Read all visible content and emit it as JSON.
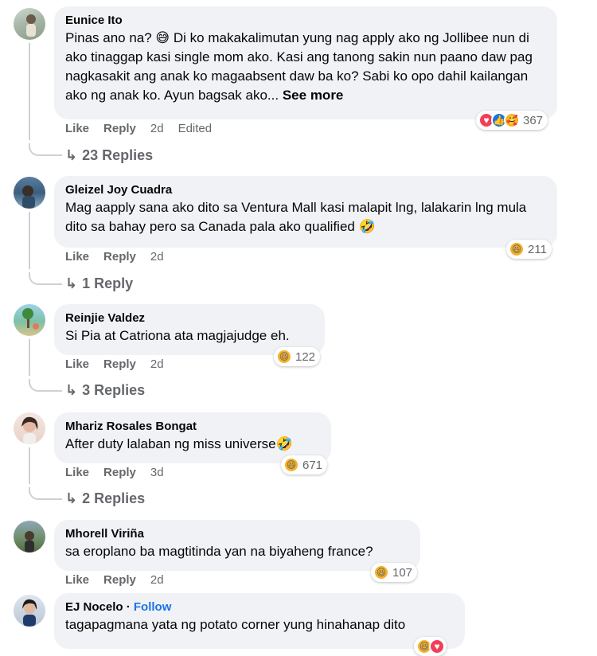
{
  "actions": {
    "like": "Like",
    "reply": "Reply"
  },
  "comments": [
    {
      "author": "Eunice Ito",
      "text": "Pinas ano na? 😅 Di ko makakalimutan yung nag apply ako ng Jollibee nun di ako tinaggap kasi single mom ako. Kasi ang tanong sakin nun paano daw pag nagkasakit ang anak ko magaabsent daw ba ko? Sabi ko opo dahil kailangan ako ng anak ko. Ayun bagsak ako...",
      "see_more": "See more",
      "time": "2d",
      "edited": "Edited",
      "reactions": [
        "heart-icon",
        "like-icon",
        "care-icon"
      ],
      "reaction_count": "367",
      "replies": "23 Replies"
    },
    {
      "author": "Gleizel Joy Cuadra",
      "text": "Mag aapply sana ako dito sa Ventura Mall kasi malapit lng, lalakarin lng mula dito sa bahay pero sa Canada pala ako qualified 🤣",
      "time": "2d",
      "reactions": [
        "haha-icon"
      ],
      "reaction_count": "211",
      "replies": "1 Reply"
    },
    {
      "author": "Reinjie Valdez",
      "text": "Si Pia at Catriona ata magjajudge eh.",
      "time": "2d",
      "reactions": [
        "haha-icon"
      ],
      "reaction_count": "122",
      "replies": "3 Replies"
    },
    {
      "author": "Mhariz Rosales Bongat",
      "text": "After duty lalaban ng miss universe🤣",
      "time": "3d",
      "reactions": [
        "haha-icon"
      ],
      "reaction_count": "671",
      "replies": "2 Replies"
    },
    {
      "author": "Mhorell Viriña",
      "text": "sa eroplano ba magtitinda yan na biyaheng france?",
      "time": "2d",
      "reactions": [
        "haha-icon"
      ],
      "reaction_count": "107"
    },
    {
      "author": "EJ Nocelo",
      "follow": "Follow",
      "separator": "·",
      "text": "tagapagmana yata ng potato corner yung hinahanap dito"
    }
  ]
}
